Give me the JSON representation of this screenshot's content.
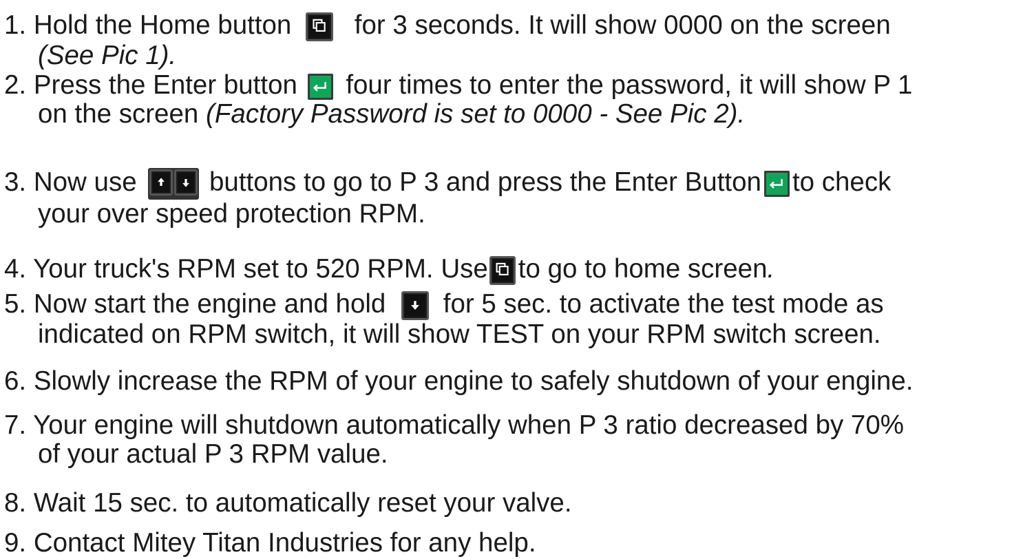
{
  "steps": [
    {
      "n": "1.",
      "a": "Hold the Home button",
      "b": "for 3 seconds. It will show 0000 on the screen",
      "c": "(See Pic 1)."
    },
    {
      "n": "2.",
      "a": "Press the Enter button",
      "b": "four times to enter the password, it will show P 1",
      "c": "on the screen",
      "d": "(Factory Password is set to 0000 - See Pic 2)."
    },
    {
      "n": "3.",
      "a": "Now use",
      "b": "buttons to go to P 3 and press the Enter Button",
      "c": "to check",
      "d": "your over speed protection RPM."
    },
    {
      "n": "4.",
      "a": "Your truck's RPM set to 520 RPM. Use",
      "b": "to go to home screen",
      "c": "."
    },
    {
      "n": "5.",
      "a": "Now start the engine and hold",
      "b": "for 5 sec. to activate the test mode as",
      "c": "indicated on RPM switch, it will show TEST on your RPM switch screen."
    },
    {
      "n": "6.",
      "a": "Slowly increase the RPM of your engine to safely shutdown of your engine."
    },
    {
      "n": "7.",
      "a": "Your engine will shutdown automatically when P 3 ratio decreased by 70%",
      "b": "of your actual P 3 RPM value."
    },
    {
      "n": "8.",
      "a": "Wait 15 sec. to automatically reset your valve."
    },
    {
      "n": "9.",
      "a": "Contact Mitey Titan Industries for any help."
    }
  ],
  "icons": {
    "home": "home-button-icon",
    "enter": "enter-button-icon",
    "up": "up-arrow-button-icon",
    "down": "down-arrow-button-icon"
  },
  "colors": {
    "text": "#1a1a1a",
    "enter_green": "#0fa65a",
    "button_dark": "#111111"
  }
}
